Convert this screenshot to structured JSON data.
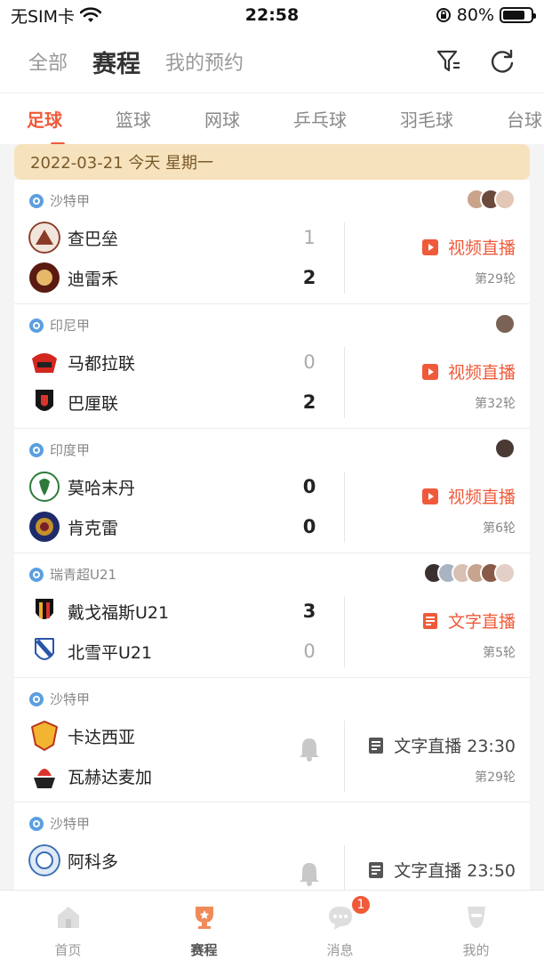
{
  "status_bar": {
    "carrier": "无SIM卡",
    "time": "22:58",
    "battery": "80%",
    "battery_level": 0.8
  },
  "header": {
    "tabs": [
      "全部",
      "赛程",
      "我的预约"
    ],
    "active_tab": "赛程"
  },
  "sport_tabs": [
    "足球",
    "篮球",
    "网球",
    "乒乓球",
    "羽毛球",
    "台球"
  ],
  "date_banner": "2022-03-21 今天 星期一",
  "matches": [
    {
      "league": "沙特甲",
      "team1": "查巴垒",
      "team2": "迪雷禾",
      "score1": "1",
      "score2": "2",
      "live": "视频直播",
      "round": "第29轮",
      "avatars": 3
    },
    {
      "league": "印尼甲",
      "team1": "马都拉联",
      "team2": "巴厘联",
      "score1": "0",
      "score2": "2",
      "live": "视频直播",
      "round": "第32轮",
      "avatars": 1
    },
    {
      "league": "印度甲",
      "team1": "莫哈末丹",
      "team2": "肯克雷",
      "score1": "0",
      "score2": "0",
      "live": "视频直播",
      "round": "第6轮",
      "avatars": 1
    },
    {
      "league": "瑞青超U21",
      "team1": "戴戈福斯U21",
      "team2": "北雪平U21",
      "score1": "3",
      "score2": "0",
      "live": "文字直播",
      "round": "第5轮",
      "avatars": 6
    },
    {
      "league": "沙特甲",
      "team1": "卡达西亚",
      "team2": "瓦赫达麦加",
      "live": "文字直播 23:30",
      "round": "第29轮"
    },
    {
      "league": "沙特甲",
      "team1": "阿科多",
      "live": "文字直播 23:50"
    }
  ],
  "tab_bar": [
    {
      "label": "首页"
    },
    {
      "label": "赛程"
    },
    {
      "label": "消息",
      "badge": "1"
    },
    {
      "label": "我的"
    }
  ],
  "colors": {
    "accent": "#f05a3a",
    "banner_bg": "#f6e2bd",
    "banner_text": "#7a5a2a"
  }
}
